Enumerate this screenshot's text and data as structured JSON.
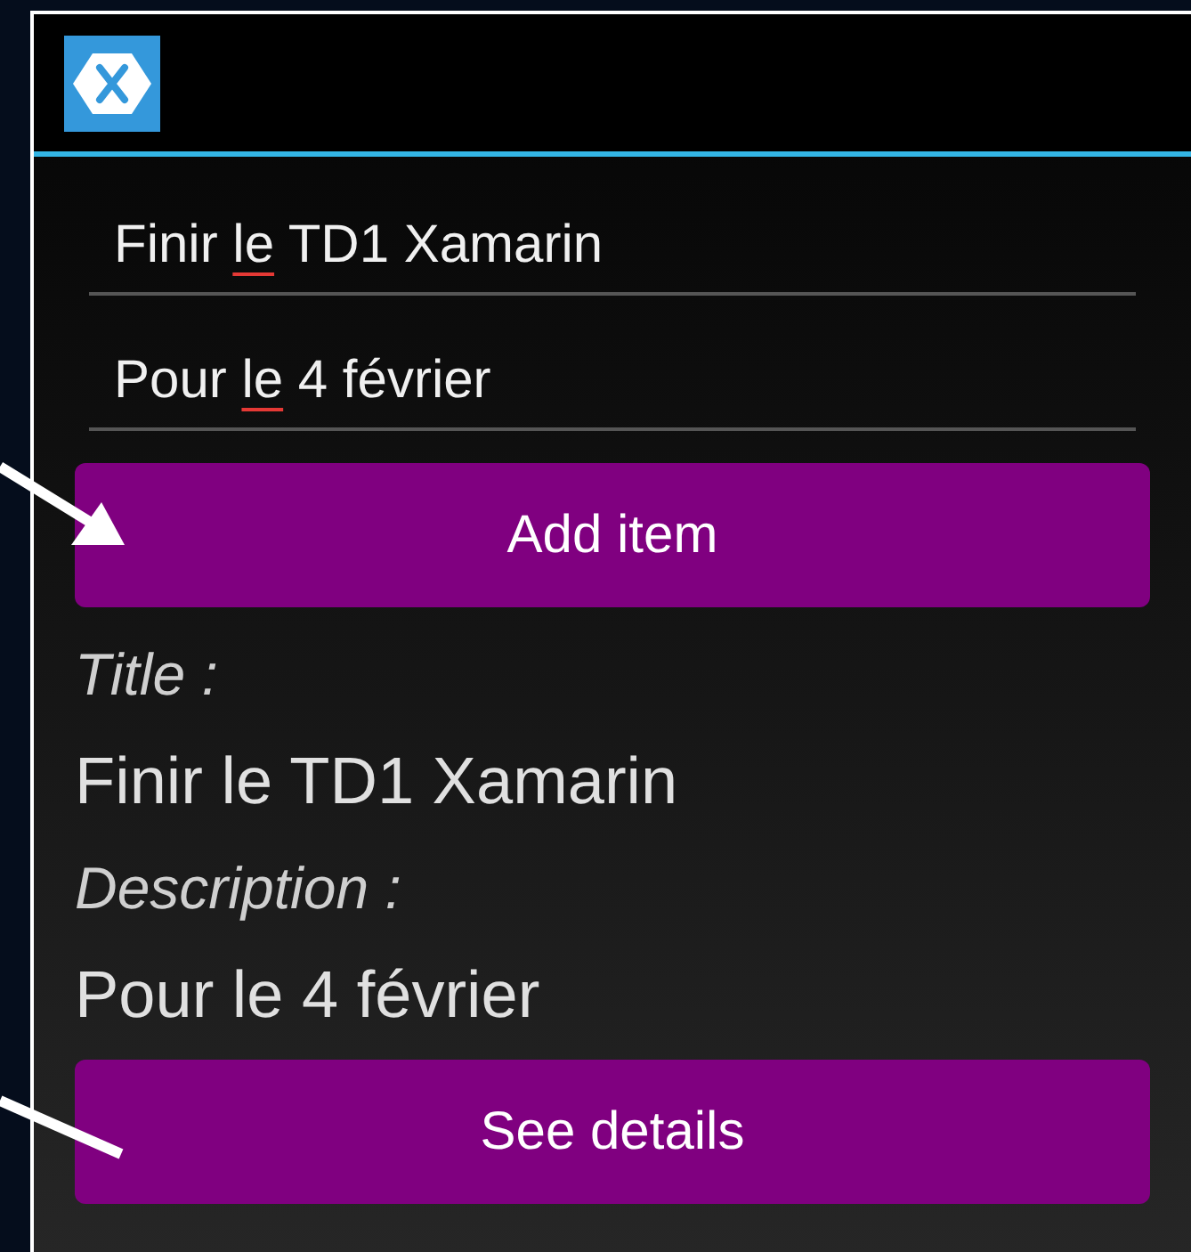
{
  "fields": [
    {
      "parts": [
        {
          "text": "Finir ",
          "flagged": false
        },
        {
          "text": "le",
          "flagged": true
        },
        {
          "text": " TD1 Xamarin",
          "flagged": false
        }
      ]
    },
    {
      "parts": [
        {
          "text": "Pour ",
          "flagged": false
        },
        {
          "text": "le",
          "flagged": true
        },
        {
          "text": " 4 février",
          "flagged": false
        }
      ]
    }
  ],
  "add_button": "Add item",
  "details": [
    {
      "kind": "label",
      "text": "Title :"
    },
    {
      "kind": "value",
      "text": "Finir le TD1 Xamarin"
    },
    {
      "kind": "label",
      "text": "Description :"
    },
    {
      "kind": "value",
      "text": "Pour le 4 février"
    }
  ],
  "details_button": "See details"
}
